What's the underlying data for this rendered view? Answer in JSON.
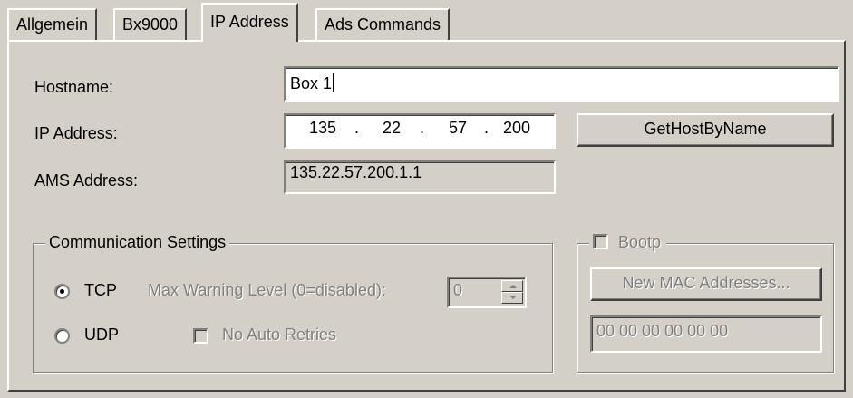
{
  "tabs": [
    "Allgemein",
    "Bx9000",
    "IP Address",
    "Ads Commands"
  ],
  "active_tab": "IP Address",
  "hostname": {
    "label": "Hostname:",
    "value": "Box 1"
  },
  "ip_address": {
    "label": "IP Address:",
    "octets": [
      "135",
      "22",
      "57",
      "200"
    ],
    "separator": "."
  },
  "get_host_button": "GetHostByName",
  "ams_address": {
    "label": "AMS Address:",
    "value": "135.22.57.200.1.1"
  },
  "communication": {
    "title": "Communication Settings",
    "tcp_label": "TCP",
    "udp_label": "UDP",
    "selected": "TCP",
    "max_warning_label": "Max Warning Level (0=disabled):",
    "max_warning_value": "0",
    "no_auto_retries_label": "No Auto Retries"
  },
  "bootp": {
    "title": "Bootp",
    "new_mac_button": "New MAC Addresses...",
    "mac_value": "00 00 00 00 00 00"
  }
}
